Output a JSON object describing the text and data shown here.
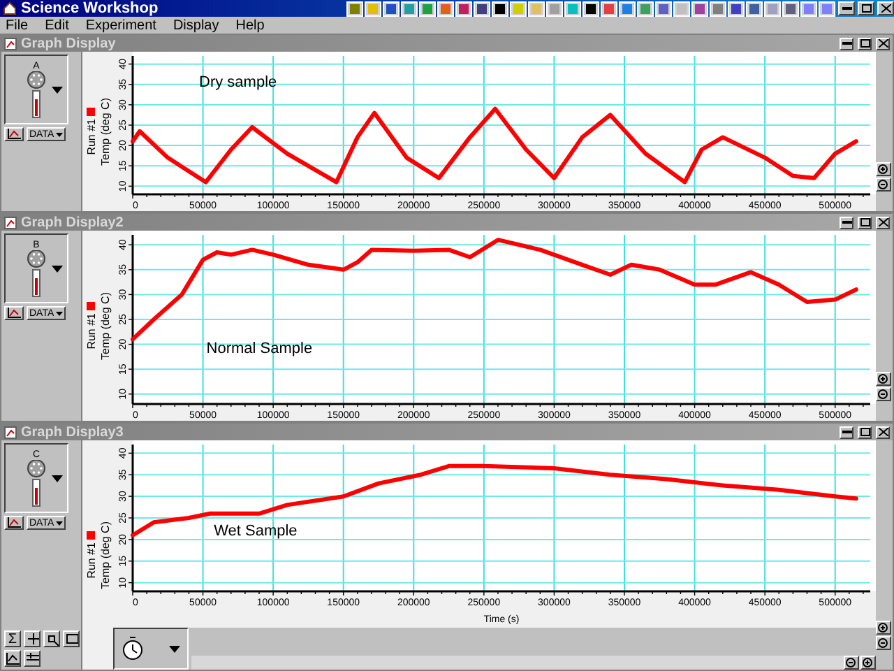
{
  "window": {
    "title": "Science Workshop"
  },
  "menu": [
    "File",
    "Edit",
    "Experiment",
    "Display",
    "Help"
  ],
  "graphs": [
    {
      "title": "Graph Display",
      "sensor": "A",
      "data_button": "DATA",
      "axis_label": "Temp (deg C)",
      "chart_data": {
        "type": "line",
        "grid": true,
        "x": [
          0,
          5000,
          25000,
          52000,
          70000,
          85000,
          110000,
          145000,
          160000,
          172000,
          195000,
          218000,
          240000,
          258000,
          280000,
          300000,
          320000,
          340000,
          365000,
          393000,
          405000,
          420000,
          450000,
          470000,
          485000,
          500000,
          515000
        ],
        "series": [
          {
            "name": "Run #1",
            "color": "#ff0000",
            "values": [
              21,
              23.5,
              17,
              11,
              19,
              24.5,
              18,
              11,
              22,
              28,
              17,
              12,
              22,
              29,
              19,
              12,
              22,
              27.5,
              18,
              11,
              19,
              22,
              17,
              12.5,
              12,
              18,
              21
            ]
          }
        ],
        "xlim": [
          0,
          525000
        ],
        "ylim": [
          8,
          42
        ],
        "xticks": [
          0,
          50000,
          100000,
          150000,
          200000,
          250000,
          300000,
          350000,
          400000,
          450000,
          500000
        ],
        "yticks": [
          10,
          15,
          20,
          25,
          30,
          35,
          40
        ],
        "annotations": [
          "Dry sample"
        ]
      }
    },
    {
      "title": "Graph Display2",
      "sensor": "B",
      "data_button": "DATA",
      "axis_label": "Temp (deg C)",
      "chart_data": {
        "type": "line",
        "grid": true,
        "x": [
          0,
          15000,
          35000,
          50000,
          60000,
          70000,
          85000,
          100000,
          125000,
          150000,
          160000,
          170000,
          200000,
          225000,
          240000,
          260000,
          290000,
          320000,
          340000,
          355000,
          375000,
          400000,
          415000,
          440000,
          460000,
          480000,
          500000,
          515000
        ],
        "series": [
          {
            "name": "Run #1",
            "color": "#ff0000",
            "values": [
              21,
              25,
              30,
              37,
              38.5,
              38,
              39,
              38,
              36,
              35,
              36.5,
              39,
              38.8,
              39,
              37.5,
              41,
              39,
              36,
              34,
              36,
              35,
              32,
              32,
              34.5,
              32,
              28.5,
              29,
              31
            ]
          }
        ],
        "xlim": [
          0,
          525000
        ],
        "ylim": [
          8,
          42
        ],
        "xticks": [
          0,
          50000,
          100000,
          150000,
          200000,
          250000,
          300000,
          350000,
          400000,
          450000,
          500000
        ],
        "yticks": [
          10,
          15,
          20,
          25,
          30,
          35,
          40
        ],
        "annotations": [
          "Normal Sample"
        ]
      }
    },
    {
      "title": "Graph Display3",
      "sensor": "C",
      "data_button": "DATA",
      "axis_label": "Temp (deg C)",
      "tool_symbol": "Σ",
      "chart_data": {
        "type": "line",
        "grid": true,
        "xlabel": "Time (s)",
        "x": [
          0,
          15000,
          40000,
          55000,
          90000,
          110000,
          150000,
          175000,
          205000,
          225000,
          250000,
          300000,
          340000,
          380000,
          420000,
          460000,
          500000,
          515000
        ],
        "series": [
          {
            "name": "Run #1",
            "color": "#ff0000",
            "values": [
              21,
              24,
              25,
              26,
              26,
              28,
              30,
              33,
              35,
              37,
              37,
              36.5,
              35,
              34,
              32.5,
              31.5,
              30,
              29.5
            ]
          }
        ],
        "xlim": [
          0,
          525000
        ],
        "ylim": [
          8,
          42
        ],
        "xticks": [
          0,
          50000,
          100000,
          150000,
          200000,
          250000,
          300000,
          350000,
          400000,
          450000,
          500000
        ],
        "yticks": [
          10,
          15,
          20,
          25,
          30,
          35,
          40
        ],
        "annotations": [
          "Wet Sample"
        ]
      }
    }
  ]
}
